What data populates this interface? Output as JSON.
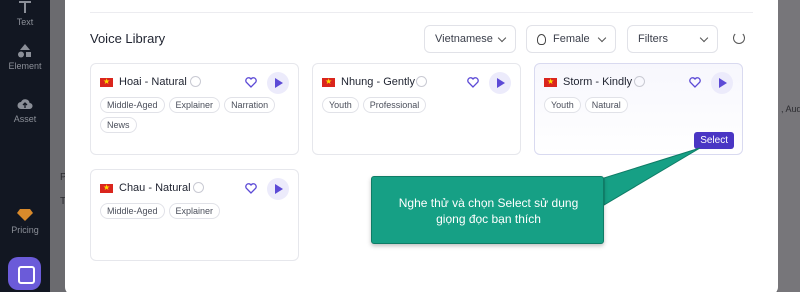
{
  "sidebar": {
    "items": [
      {
        "label": "Text",
        "icon": "text-icon"
      },
      {
        "label": "Element",
        "icon": "shapes-icon"
      },
      {
        "label": "Asset",
        "icon": "cloud-upload-icon"
      },
      {
        "label": "Pricing",
        "icon": "diamond-icon"
      }
    ],
    "chat_icon": "chat-icon"
  },
  "background": {
    "right_fragment": ", Aud...",
    "letters": [
      "P",
      "T"
    ]
  },
  "library": {
    "title": "Voice Library",
    "language_select": "Vietnamese",
    "gender_select": "Female",
    "filters_select": "Filters",
    "refresh_icon": "refresh-icon"
  },
  "voices": [
    {
      "name": "Hoai - Natural",
      "tags": [
        "Middle-Aged",
        "Explainer",
        "Narration",
        "News"
      ]
    },
    {
      "name": "Nhung - Gently",
      "tags": [
        "Youth",
        "Professional"
      ]
    },
    {
      "name": "Storm - Kindly",
      "tags": [
        "Youth",
        "Natural"
      ],
      "select_label": "Select"
    },
    {
      "name": "Chau - Natural",
      "tags": [
        "Middle-Aged",
        "Explainer"
      ]
    }
  ],
  "callout": {
    "text": "Nghe thử và chọn Select sử dụng giọng đọc bạn thích"
  },
  "colors": {
    "accent": "#4a36c4",
    "callout": "#16a085",
    "flag_red": "#da251d",
    "flag_star": "#ffdd00"
  }
}
